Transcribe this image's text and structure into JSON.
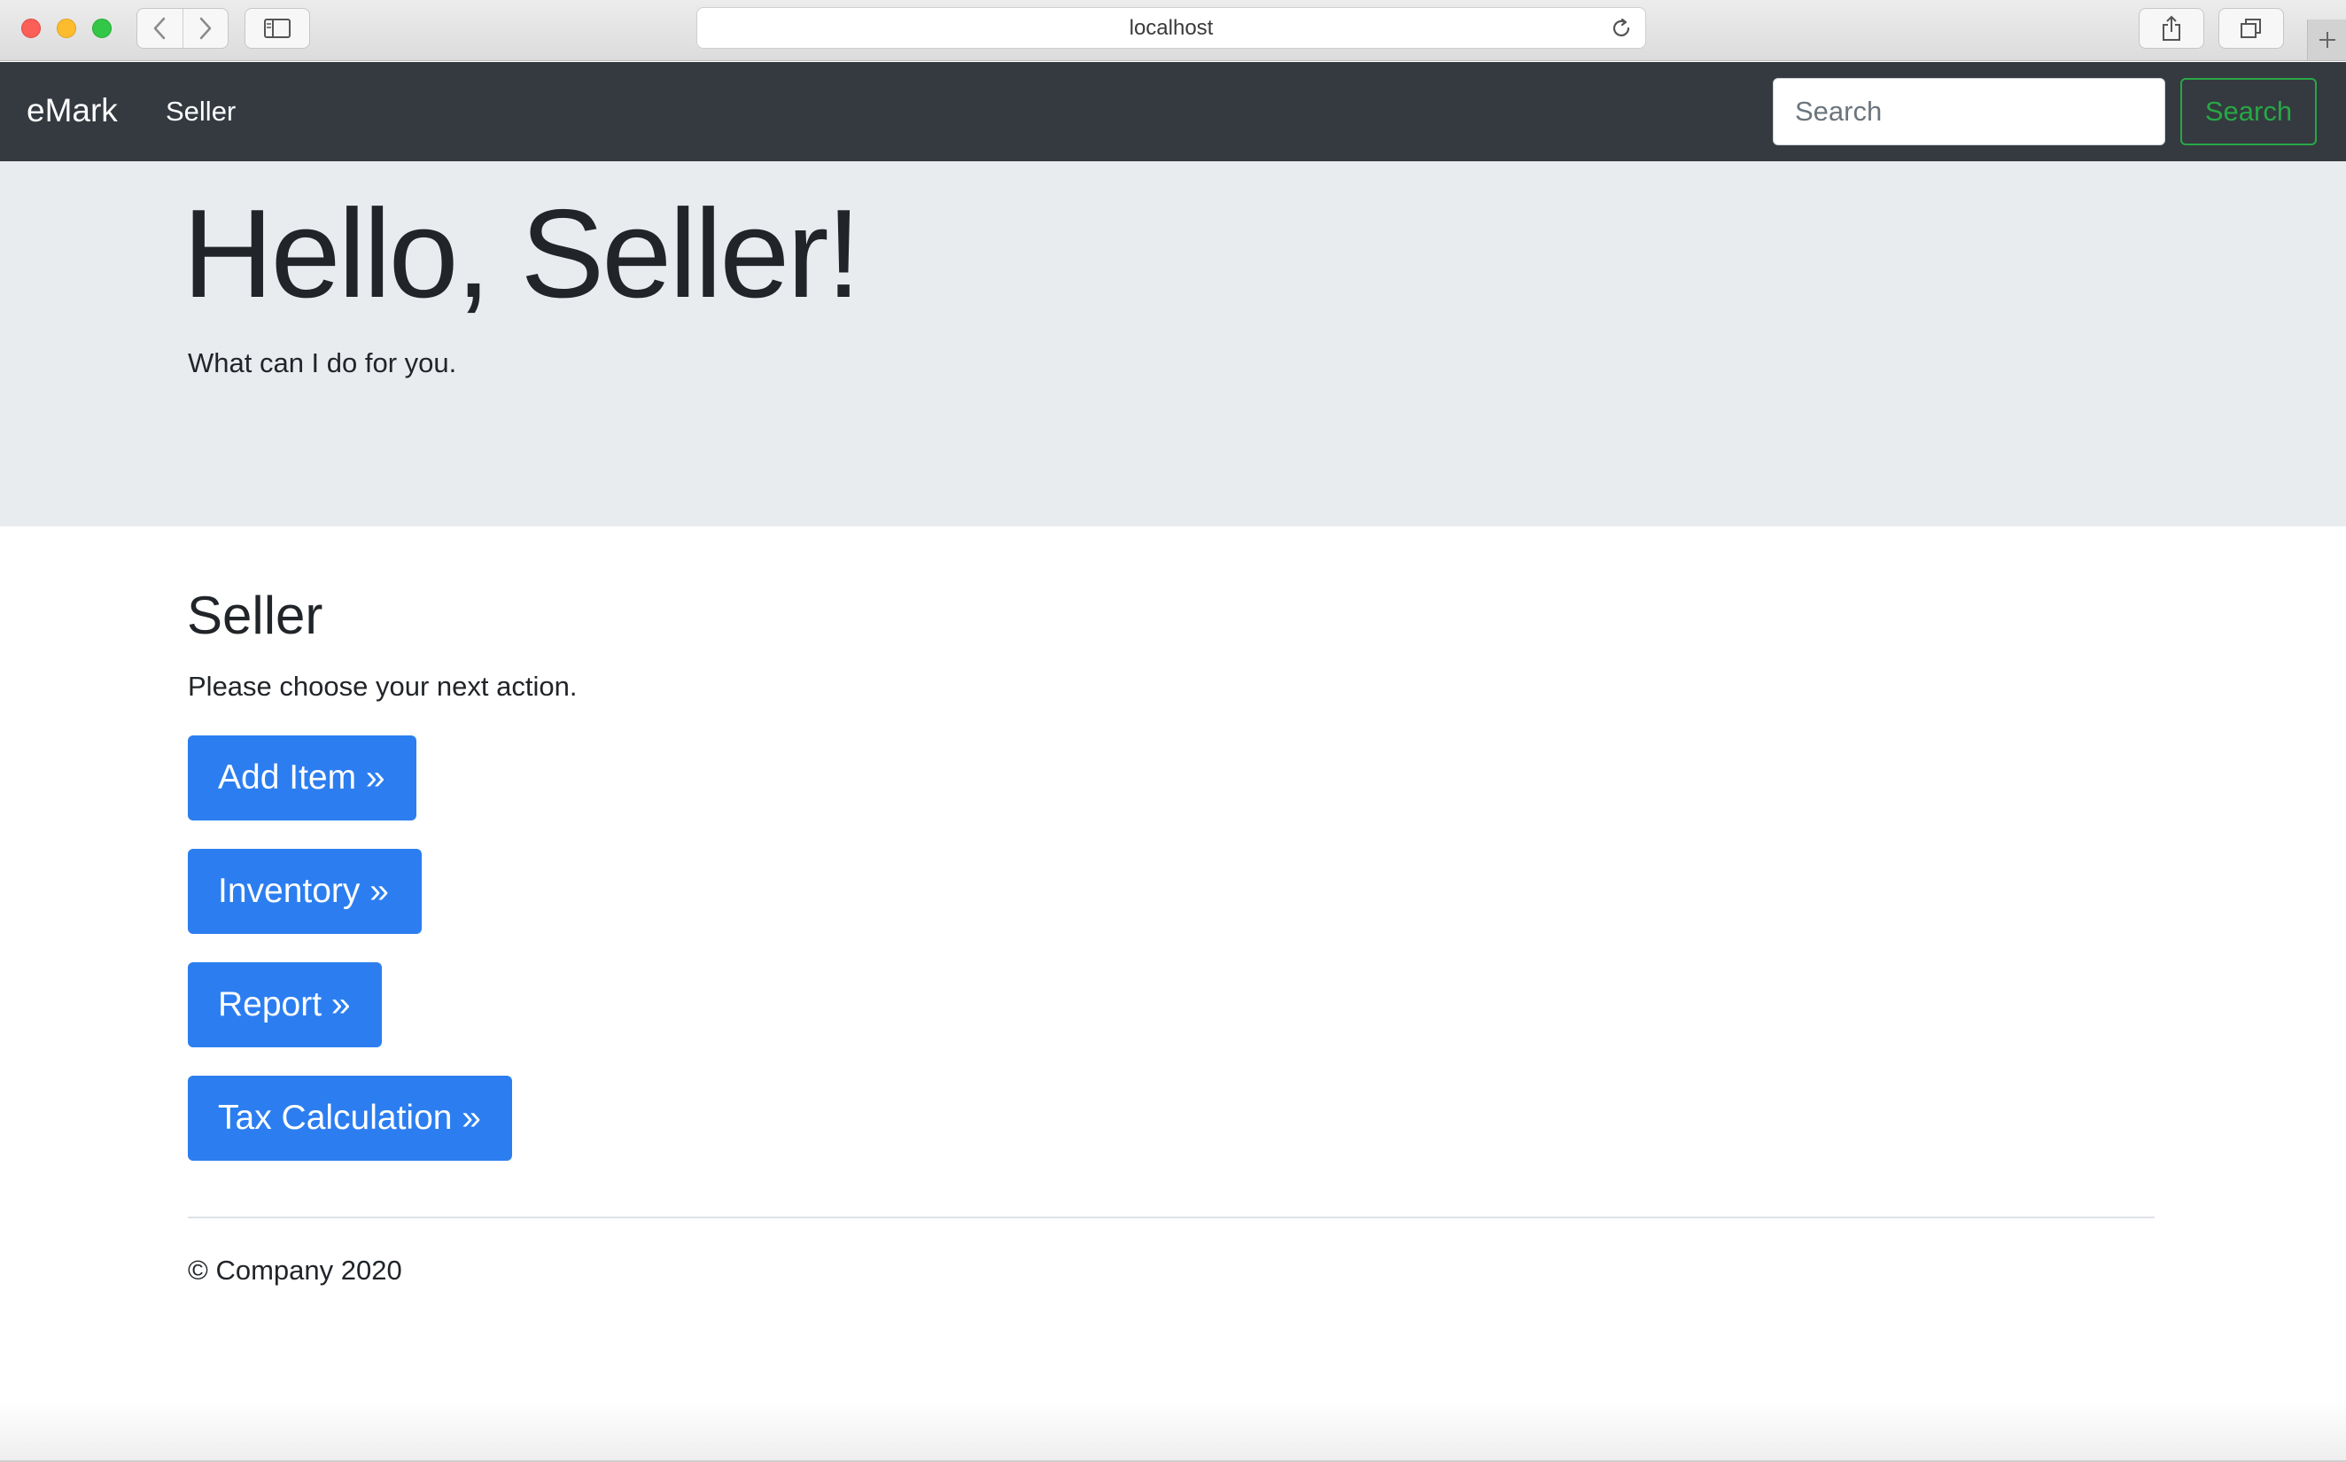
{
  "browser": {
    "address": "localhost"
  },
  "navbar": {
    "brand": "eMark",
    "nav_link": "Seller",
    "search_placeholder": "Search",
    "search_button": "Search"
  },
  "jumbotron": {
    "title": "Hello, Seller!",
    "subtitle": "What can I do for you."
  },
  "main": {
    "heading": "Seller",
    "description": "Please choose your next action.",
    "buttons": [
      {
        "label": "Add Item »"
      },
      {
        "label": "Inventory »"
      },
      {
        "label": "Report »"
      },
      {
        "label": "Tax Calculation »"
      }
    ],
    "button_color": "#2c7ef0"
  },
  "footer": {
    "text": "© Company 2020"
  },
  "colors": {
    "navbar_bg": "#343a40",
    "jumbotron_bg": "#e9ecef",
    "search_button_accent": "#28a745"
  }
}
